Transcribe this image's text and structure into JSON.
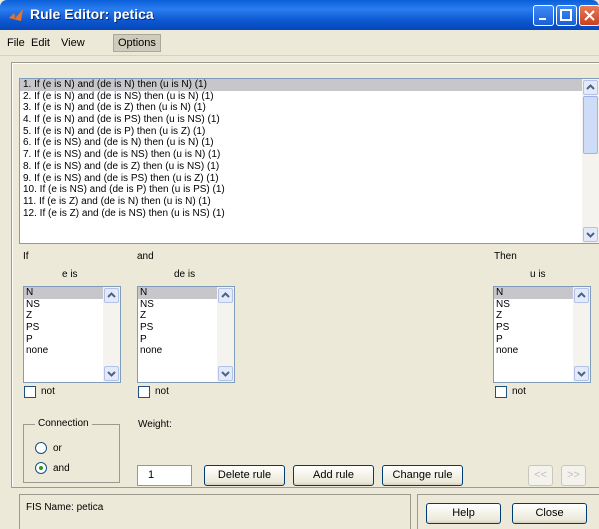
{
  "window": {
    "title": "Rule Editor: petica"
  },
  "menu": [
    "File",
    "Edit",
    "View",
    "Options"
  ],
  "rules": [
    "1. If (e is N) and (de is N) then (u is N) (1)",
    "2. If (e is N) and (de is NS) then (u is N) (1)",
    "3. If (e is N) and (de is Z) then (u is N) (1)",
    "4. If (e is N) and (de is PS) then (u is NS) (1)",
    "5. If (e is N) and (de is P) then (u is Z) (1)",
    "6. If (e is NS) and (de is N) then (u is N) (1)",
    "7. If (e is NS) and (de is NS) then (u is N) (1)",
    "8. If (e is NS) and (de is Z) then (u is NS) (1)",
    "9. If (e is NS) and (de is PS) then (u is Z) (1)",
    "10. If (e is NS) and (de is P) then (u is PS) (1)",
    "11. If (e is Z) and (de is N) then (u is N) (1)",
    "12. If (e is Z) and (de is NS) then (u is NS) (1)"
  ],
  "if_label": "If",
  "and_label": "and",
  "then_label": "Then",
  "e_label": "e is",
  "de_label": "de is",
  "u_label": "u is",
  "options": [
    "N",
    "NS",
    "Z",
    "PS",
    "P",
    "none"
  ],
  "not_label": "not",
  "connection_label": "Connection",
  "or_label": "or",
  "and_radio_label": "and",
  "weight_label": "Weight:",
  "weight_value": "1",
  "buttons": {
    "delete": "Delete rule",
    "add": "Add rule",
    "change": "Change rule",
    "prev": "<<",
    "next": ">>",
    "help": "Help",
    "close": "Close"
  },
  "status": "FIS Name: petica"
}
